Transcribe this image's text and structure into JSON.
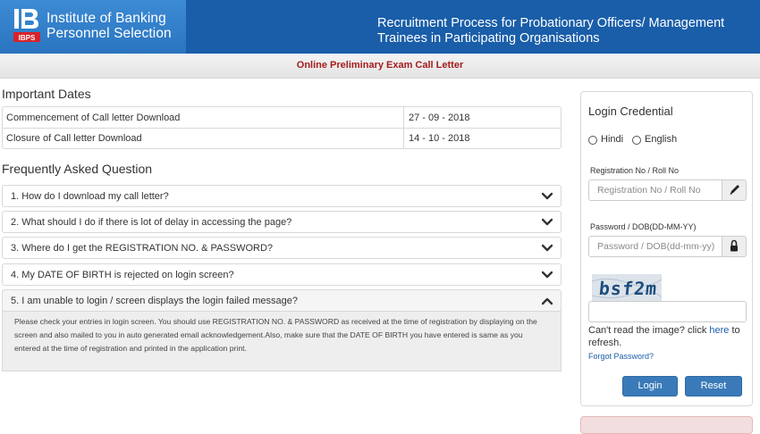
{
  "header": {
    "org_line1": "Institute of Banking",
    "org_line2": "Personnel Selection",
    "logo_text": "IBPS",
    "title": "Recruitment Process for Probationary Officers/ Management Trainees in Participating Organisations"
  },
  "subbar": {
    "text": "Online Preliminary Exam Call Letter"
  },
  "important_dates": {
    "title": "Important Dates",
    "rows": [
      {
        "label": "Commencement of Call letter Download",
        "date": "27 - 09 - 2018"
      },
      {
        "label": "Closure of Call letter Download",
        "date": "14 - 10 - 2018"
      }
    ]
  },
  "faq": {
    "title": "Frequently Asked Question",
    "items": [
      {
        "question": "1. How do I download my call letter?",
        "expanded": false
      },
      {
        "question": "2. What should I do if there is lot of delay in accessing the page?",
        "expanded": false
      },
      {
        "question": "3. Where do I get the REGISTRATION NO. & PASSWORD?",
        "expanded": false
      },
      {
        "question": "4. My DATE OF BIRTH is rejected on login screen?",
        "expanded": false
      },
      {
        "question": "5. I am unable to login / screen displays the login failed message?",
        "expanded": true
      }
    ],
    "answer_5": "Please check your entries in login screen. You should use REGISTRATION NO. & PASSWORD as received at the time of registration by displaying on the screen and also mailed to you in auto generated email acknowledgement.Also, make sure that the DATE OF BIRTH you have entered is same as you entered at the time of registration and printed in the application print."
  },
  "login": {
    "title": "Login Credential",
    "languages": [
      "Hindi",
      "English"
    ],
    "reg_label": "Registration No / Roll No",
    "reg_placeholder": "Registration No / Roll No",
    "pwd_label": "Password / DOB(DD-MM-YY)",
    "pwd_placeholder": "Password / DOB(dd-mm-yy)",
    "captcha_text": "bsf2m",
    "captcha_value": "",
    "cant_read_prefix": "Can't read the image? click",
    "cant_read_link": "here",
    "cant_read_suffix": "to refresh.",
    "forgot_password": "Forgot Password?",
    "login_button": "Login",
    "reset_button": "Reset"
  },
  "colors": {
    "header_blue": "#1a5ea9",
    "subbar_text": "#a51c1c",
    "button_blue": "#3a7ab8",
    "link_blue": "#1a5ea9",
    "alert_bg": "#f2dede"
  },
  "icons": {
    "chevron_collapsed": "chevron-down-icon",
    "chevron_expanded": "chevron-up-icon",
    "reg_addon": "pencil-icon",
    "pwd_addon": "lock-icon"
  }
}
